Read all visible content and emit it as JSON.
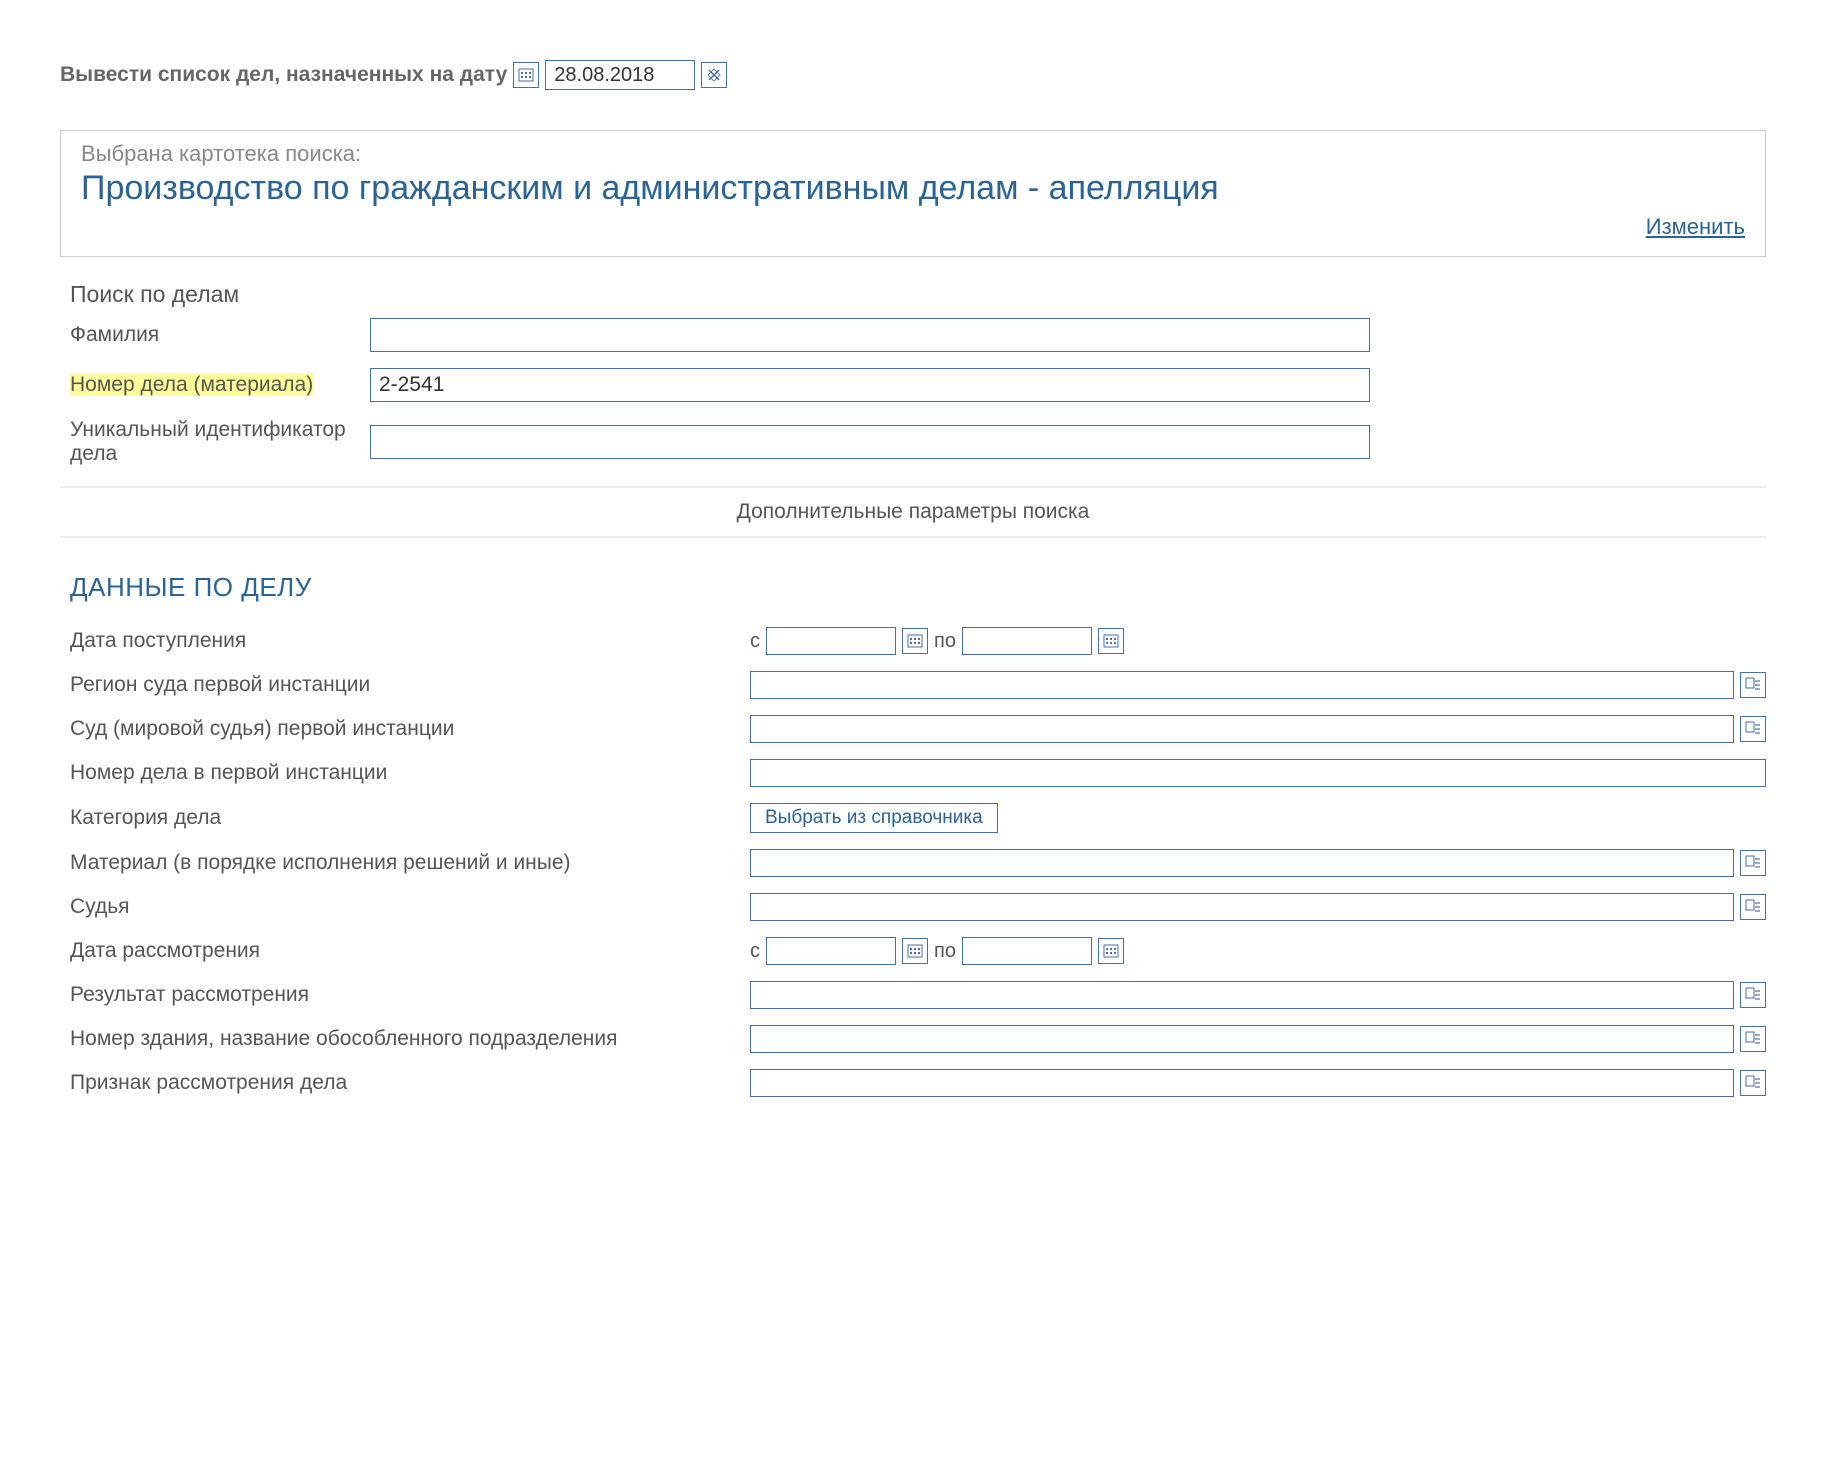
{
  "top": {
    "label": "Вывести список дел, назначенных на дату",
    "date_value": "28.08.2018"
  },
  "card": {
    "small": "Выбрана картотека поиска:",
    "title": "Производство по гражданским и административным делам - апелляция",
    "change": "Изменить"
  },
  "search": {
    "header": "Поиск по делам",
    "surname_label": "Фамилия",
    "surname_value": "",
    "case_no_label": "Номер дела (материала)",
    "case_no_value": "2-2541",
    "uid_label": "Уникальный идентификатор дела",
    "uid_value": ""
  },
  "extra_label": "Дополнительные параметры поиска",
  "detail_heading": "ДАННЫЕ ПО ДЕЛУ",
  "range": {
    "from": "с",
    "to": "по"
  },
  "choose_ref": "Выбрать из справочника",
  "details": {
    "r0": "Дата поступления",
    "r1": "Регион суда первой инстанции",
    "r2": "Суд (мировой судья) первой инстанции",
    "r3": "Номер дела в первой инстанции",
    "r4": "Категория дела",
    "r5": "Материал (в порядке исполнения решений и иные)",
    "r6": "Судья",
    "r7": "Дата рассмотрения",
    "r8": "Результат рассмотрения",
    "r9": "Номер здания, название обособленного подразделения",
    "r10": "Признак рассмотрения дела"
  }
}
